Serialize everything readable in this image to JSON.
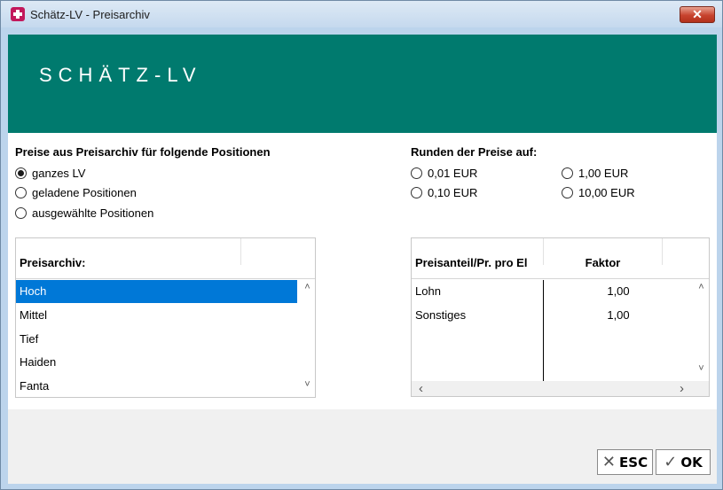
{
  "window": {
    "title": "Schätz-LV - Preisarchiv",
    "close_glyph": "✕"
  },
  "banner": {
    "text": "SCHÄTZ-LV",
    "color": "#007a6e"
  },
  "source_group": {
    "label": "Preise aus Preisarchiv für folgende Positionen",
    "options": [
      {
        "label": "ganzes LV",
        "checked": true
      },
      {
        "label": "geladene Positionen",
        "checked": false
      },
      {
        "label": "ausgewählte Positionen",
        "checked": false
      }
    ]
  },
  "rounding_group": {
    "label": "Runden der Preise auf:",
    "options": [
      {
        "label": "0,01 EUR",
        "checked": false
      },
      {
        "label": "0,10 EUR",
        "checked": false
      },
      {
        "label": "1,00 EUR",
        "checked": false
      },
      {
        "label": "10,00 EUR",
        "checked": false
      }
    ]
  },
  "archive_list": {
    "header": "Preisarchiv:",
    "items": [
      "Hoch",
      "Mittel",
      "Tief",
      "Haiden",
      "Fanta"
    ],
    "selected": "Hoch"
  },
  "factor_table": {
    "columns": [
      "Preisanteil/Pr. pro El",
      "Faktor"
    ],
    "rows": [
      {
        "name": "Lohn",
        "factor": "1,00"
      },
      {
        "name": "Sonstiges",
        "factor": "1,00"
      }
    ]
  },
  "buttons": {
    "esc": {
      "label": "ESC",
      "icon": "✕"
    },
    "ok": {
      "label": "OK",
      "icon": "✓"
    }
  },
  "scroll_glyphs": {
    "up": "˄",
    "down": "˅",
    "left": "‹",
    "right": "›"
  }
}
